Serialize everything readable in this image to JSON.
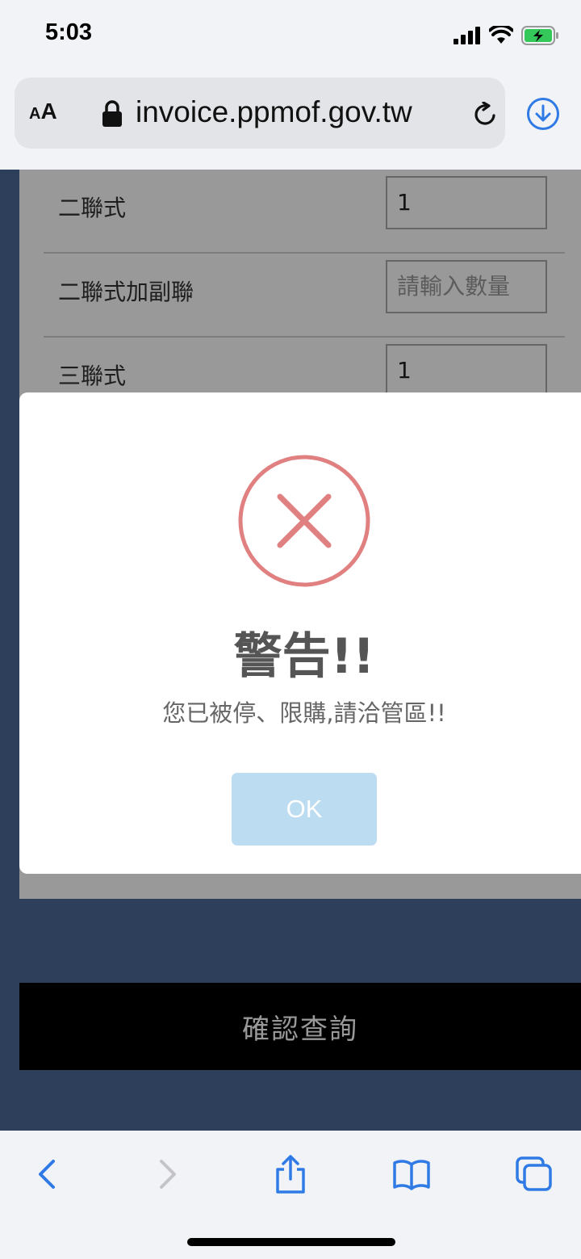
{
  "status_bar": {
    "time": "5:03",
    "battery_color": "#34c759"
  },
  "browser": {
    "aa_small": "A",
    "aa_large": "A",
    "url": "invoice.ppmof.gov.tw",
    "accent_color": "#2f7ae5"
  },
  "form": {
    "rows": [
      {
        "label": "二聯式",
        "value": "1",
        "placeholder": ""
      },
      {
        "label": "二聯式加副聯",
        "value": "",
        "placeholder": "請輸入數量"
      },
      {
        "label": "三聯式",
        "value": "1",
        "placeholder": ""
      }
    ],
    "confirm_label": "確認查詢"
  },
  "dialog": {
    "icon": "error-x-icon",
    "icon_color": "#e08080",
    "title": "警告!!",
    "message": "您已被停、限購,請洽管區!!",
    "ok_label": "OK"
  },
  "toolbar": {
    "icons": [
      "back-icon",
      "forward-icon",
      "share-icon",
      "bookmarks-icon",
      "tabs-icon"
    ]
  }
}
